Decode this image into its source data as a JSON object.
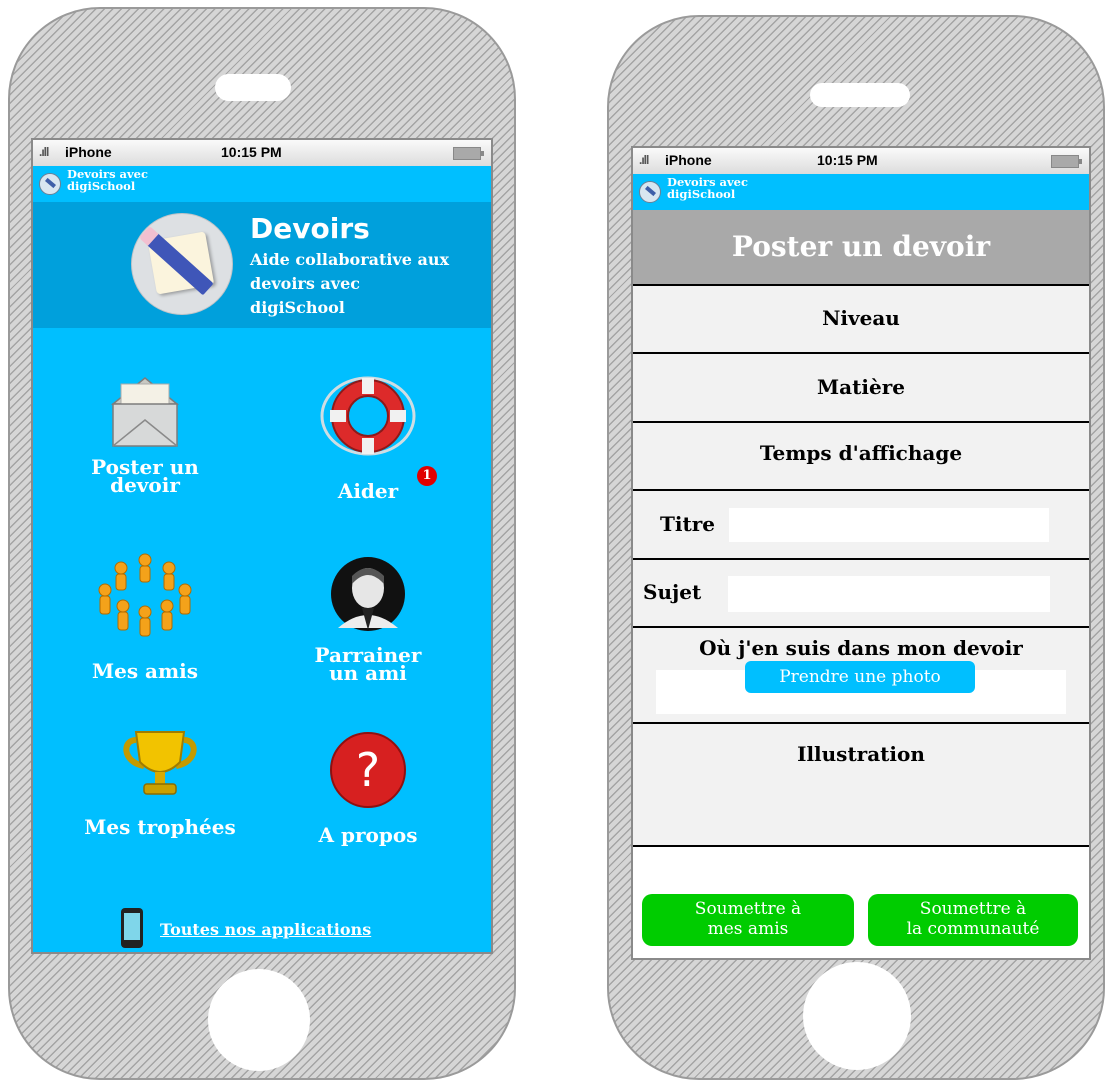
{
  "status_bar": {
    "carrier": "iPhone",
    "time": "10:15 PM"
  },
  "app_bar": {
    "title": "Devoirs avec\ndigiSchool"
  },
  "home": {
    "banner": {
      "title": "Devoirs",
      "subtitle": "Aide collaborative aux devoirs avec digiSchool"
    },
    "menu": [
      {
        "label": "Poster un devoir",
        "icon": "envelope-icon"
      },
      {
        "label": "Aider",
        "icon": "lifebuoy-icon",
        "badge": "1"
      },
      {
        "label": "Mes amis",
        "icon": "friends-circle-icon"
      },
      {
        "label": "Parrainer un ami",
        "icon": "portrait-icon"
      },
      {
        "label": "Mes trophées",
        "icon": "trophy-icon"
      },
      {
        "label": "A propos",
        "icon": "question-icon"
      }
    ],
    "footer_link": "Toutes nos applications"
  },
  "post_form": {
    "header": "Poster un devoir",
    "fields": {
      "level": "Niveau",
      "subject_matter": "Matière",
      "display_time": "Temps d'affichage",
      "title_label": "Titre",
      "title_value": "",
      "topic_label": "Sujet",
      "topic_value": "",
      "progress_label": "Où j'en suis dans mon devoir",
      "progress_value": "",
      "illustration": "Illustration"
    },
    "photo_button": "Prendre une photo",
    "submit_friends": "Soumettre à\nmes amis",
    "submit_community": "Soumettre à\nla communauté"
  },
  "colors": {
    "app_blue": "#00bfff",
    "banner_blue": "#00a0dc",
    "header_gray": "#a9a9a9",
    "submit_green": "#00cc00",
    "badge_red": "#e10000"
  }
}
